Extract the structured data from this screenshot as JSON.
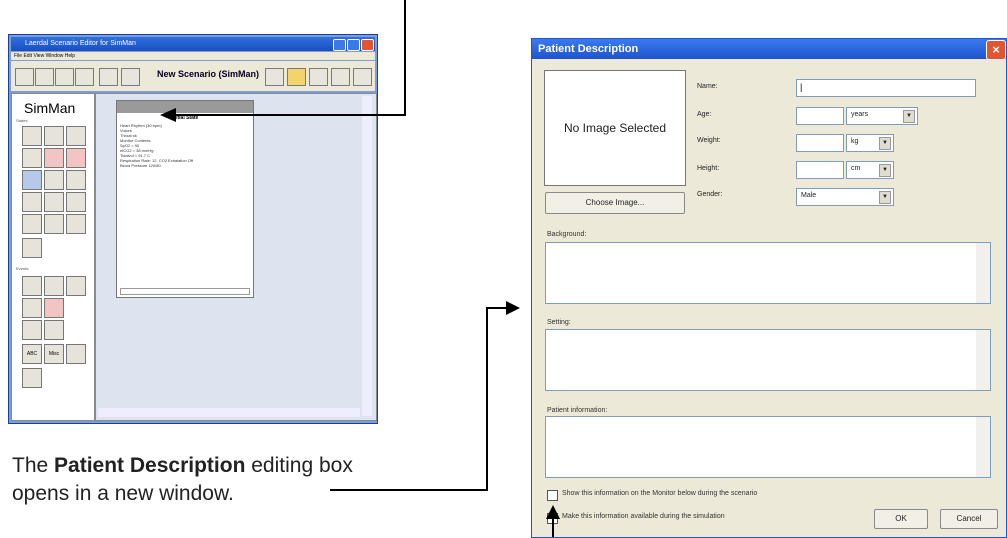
{
  "editor_window": {
    "title": "Laerdal Scenario Editor for SimMan",
    "menu": "File  Edit  View  Window  Help",
    "scenario_label": "New Scenario (SimMan)",
    "logo": "SimMan",
    "states_label": "States:",
    "events_label": "Events:",
    "event_button_abc": "ABC",
    "event_button_misc": "Misc",
    "card": {
      "title": "Initial State",
      "lines": [
        "Heart Rhythm (30 bpm)",
        "Voices",
        "Throat ok",
        "Monitor Contents",
        "SpO2 = 90",
        "etCO2 = 38 mmHg",
        "Tidalvol = 91.7 C",
        "Respiration Rate: 12, CO2 Exhalation Off",
        "Blood Pressure 120/80"
      ]
    }
  },
  "dialog": {
    "title": "Patient Description",
    "image_placeholder": "No Image Selected",
    "choose_image": "Choose Image...",
    "fields": {
      "name_label": "Name:",
      "name_value": "|",
      "age_label": "Age:",
      "age_unit": "years",
      "weight_label": "Weight:",
      "weight_unit": "kg",
      "height_label": "Height:",
      "height_unit": "cm",
      "gender_label": "Gender:",
      "gender_value": "Male"
    },
    "background_label": "Background:",
    "setting_label": "Setting:",
    "patient_info_label": "Patient information:",
    "show_monitor": "Show this information on the Monitor below during the scenario",
    "make_available": "Make this information available during the simulation",
    "ok": "OK",
    "cancel": "Cancel"
  },
  "caption": {
    "pre": "The ",
    "bold": "Patient Description",
    "post": " editing box",
    "line2": "opens in a new window."
  }
}
